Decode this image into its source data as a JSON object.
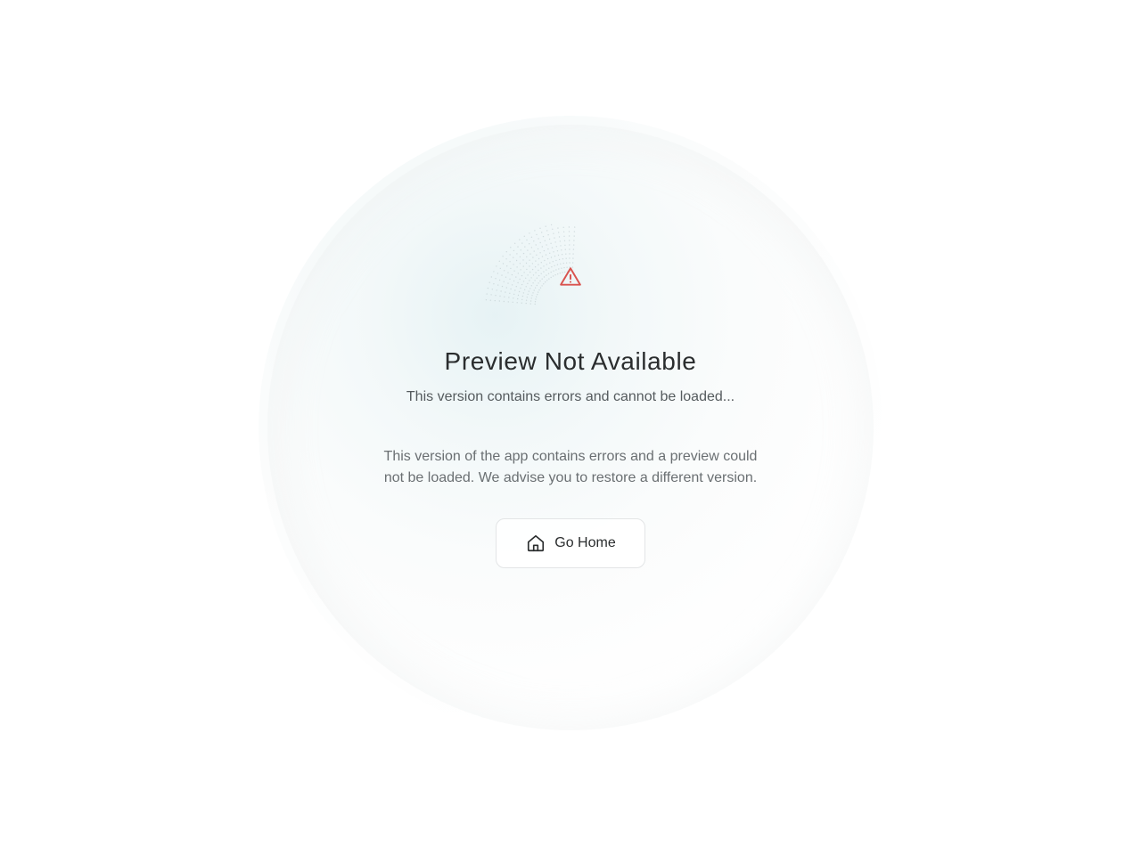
{
  "error": {
    "icon": "warning-triangle-icon",
    "title": "Preview Not Available",
    "subtitle": "This version contains errors and cannot be loaded...",
    "description": "This version of the app contains errors and a preview could not be loaded. We advise you to restore a different version."
  },
  "actions": {
    "home_icon": "home-icon",
    "home_label": "Go Home"
  },
  "colors": {
    "warning": "#d9534f",
    "text_primary": "#2a2d2e",
    "text_secondary": "#555b5e",
    "text_muted": "#6a6f72",
    "glow": "#d2e8ec"
  }
}
